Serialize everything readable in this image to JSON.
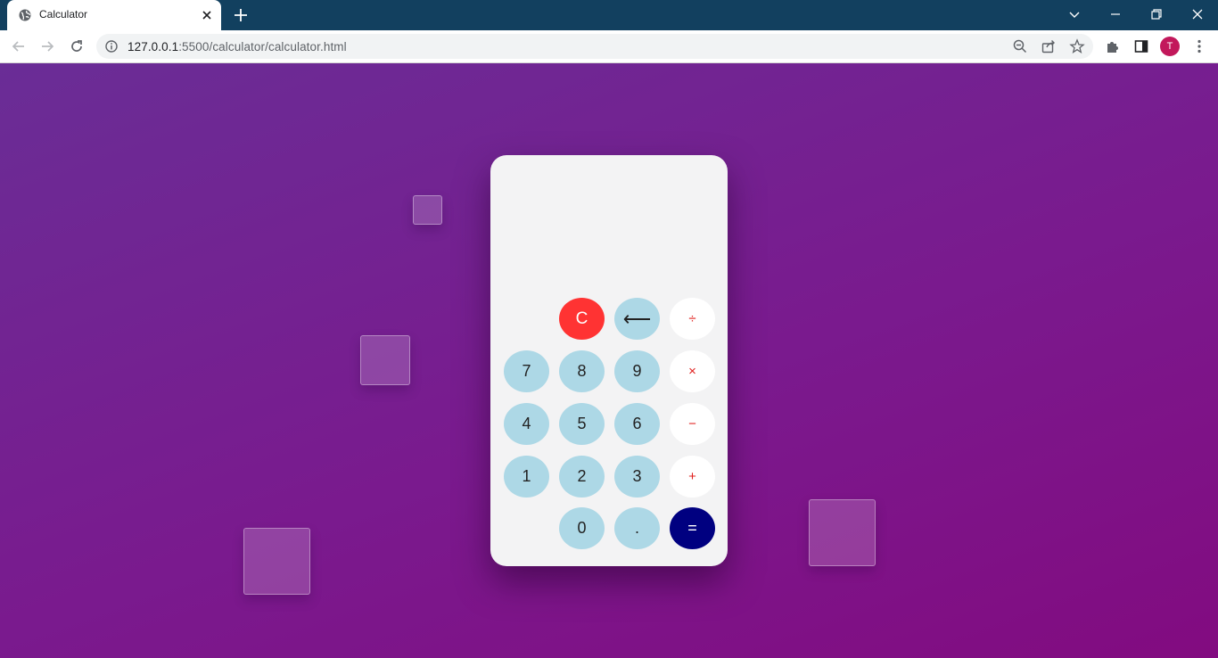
{
  "browser": {
    "tab_title": "Calculator",
    "url_host": "127.0.0.1",
    "url_rest": ":5500/calculator/calculator.html",
    "profile_initial": "T"
  },
  "calculator": {
    "display": "",
    "keys": {
      "clear": "C",
      "backspace": "⟵",
      "divide": "÷",
      "multiply": "×",
      "subtract": "−",
      "add": "+",
      "equals": "=",
      "decimal": ".",
      "d0": "0",
      "d1": "1",
      "d2": "2",
      "d3": "3",
      "d4": "4",
      "d5": "5",
      "d6": "6",
      "d7": "7",
      "d8": "8",
      "d9": "9"
    }
  },
  "colors": {
    "background_start": "#6a2d96",
    "background_end": "#820b80",
    "digit_key": "#add8e6",
    "clear_key": "#ff3333",
    "equals_key": "#000080",
    "operator_text": "#e0201e"
  }
}
